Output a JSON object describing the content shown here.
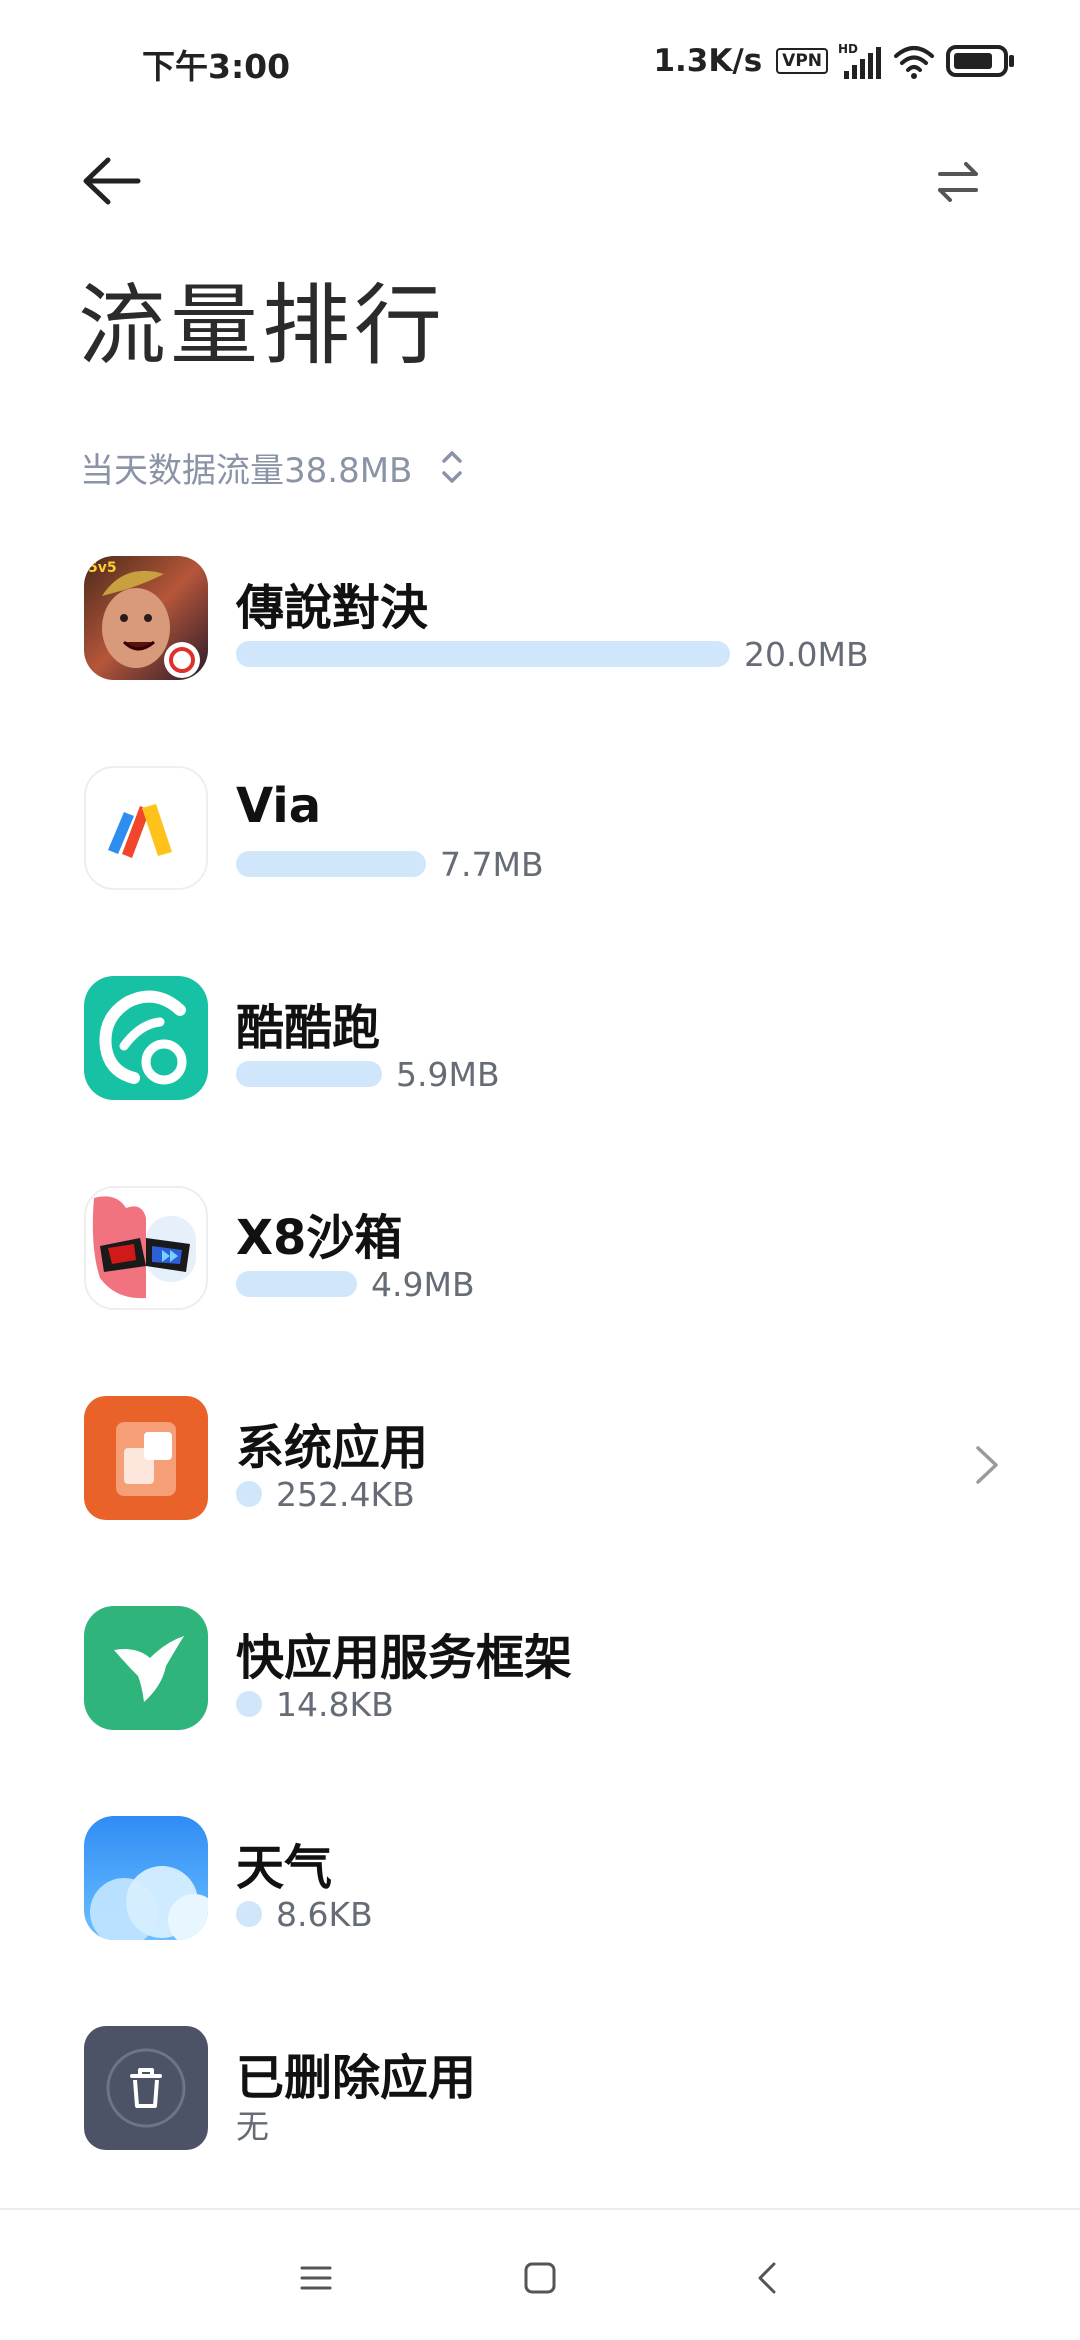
{
  "status_bar": {
    "time": "下午3:00",
    "net_speed": "1.3K/s",
    "vpn": "VPN",
    "signal_label": "HD"
  },
  "header": {
    "title": "流量排行",
    "period": "当天数据流量38.8MB"
  },
  "apps": [
    {
      "name": "傳說對決",
      "usage": "20.0MB",
      "usage_fraction": 1.0,
      "icon": "game-hero-icon"
    },
    {
      "name": "Via",
      "usage": "7.7MB",
      "usage_fraction": 0.385,
      "icon": "via-browser-icon"
    },
    {
      "name": "酷酷跑",
      "usage": "5.9MB",
      "usage_fraction": 0.295,
      "icon": "kukupao-icon"
    },
    {
      "name": "X8沙箱",
      "usage": "4.9MB",
      "usage_fraction": 0.245,
      "icon": "x8-sandbox-icon"
    },
    {
      "name": "系统应用",
      "usage": "252.4KB",
      "usage_fraction": 0.013,
      "icon": "system-apps-icon"
    },
    {
      "name": "快应用服务框架",
      "usage": "14.8KB",
      "usage_fraction": 0.001,
      "icon": "quick-app-hummingbird-icon"
    },
    {
      "name": "天气",
      "usage": "8.6KB",
      "usage_fraction": 0.0004,
      "icon": "weather-cloud-icon"
    },
    {
      "name": "已删除应用",
      "usage": "无",
      "icon": "trash-icon"
    }
  ],
  "colors": {
    "usage_bar": "#cfe6fb",
    "muted_text": "#8b93a6"
  }
}
